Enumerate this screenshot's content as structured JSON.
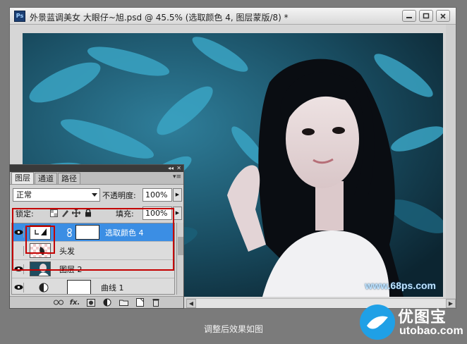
{
  "window": {
    "app_badge": "Ps",
    "title": "外景蓝调美女  大眼仔~旭.psd @ 45.5% (选取颜色 4, 图层蒙版/8) *"
  },
  "photo": {
    "watermark": "www.68ps.com"
  },
  "layers_panel": {
    "tabs": [
      {
        "label": "图层",
        "active": true
      },
      {
        "label": "通道",
        "active": false
      },
      {
        "label": "路径",
        "active": false
      }
    ],
    "blend_mode": "正常",
    "opacity_label": "不透明度:",
    "opacity_value": "100%",
    "lock_label": "锁定:",
    "fill_label": "填充:",
    "fill_value": "100%",
    "layers": [
      {
        "name": "选取颜色 4",
        "selected": true
      },
      {
        "name": "头发",
        "selected": false
      },
      {
        "name": "图层 2",
        "selected": false
      },
      {
        "name": "曲线 1",
        "selected": false
      }
    ],
    "bottom_fx": "fx."
  },
  "caption": "调整后效果如图",
  "logo": {
    "name": "优图宝",
    "domain": "utobao.com"
  }
}
